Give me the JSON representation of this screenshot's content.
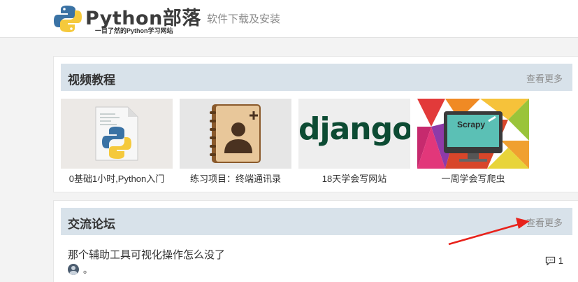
{
  "header": {
    "logo_title": "Python部落",
    "logo_tagline": "一目了然的Python学习网站",
    "nav_link": "软件下载及安装"
  },
  "video_section": {
    "title": "视频教程",
    "more": "查看更多",
    "items": [
      {
        "caption": "0基础1小时,Python入门",
        "image": "python-file-icon"
      },
      {
        "caption": "练习项目：终端通讯录",
        "image": "address-book-icon"
      },
      {
        "caption": "18天学会写网站",
        "image": "django-logo",
        "logo_text": "django"
      },
      {
        "caption": "一周学会写爬虫",
        "image": "scrapy-monitor",
        "screen_text": "Scrapy"
      }
    ]
  },
  "forum_section": {
    "title": "交流论坛",
    "more": "查看更多",
    "posts": [
      {
        "title": "那个辅助工具可视化操作怎么没了",
        "meta": "。",
        "comments": "1"
      }
    ]
  },
  "annotation": {
    "type": "red-arrow",
    "color": "#e8221b",
    "points_to": "forum-more-link"
  },
  "colors": {
    "section_header": "#d8e2ea",
    "django_green": "#0c4b33",
    "annotation_red": "#e8221b"
  }
}
